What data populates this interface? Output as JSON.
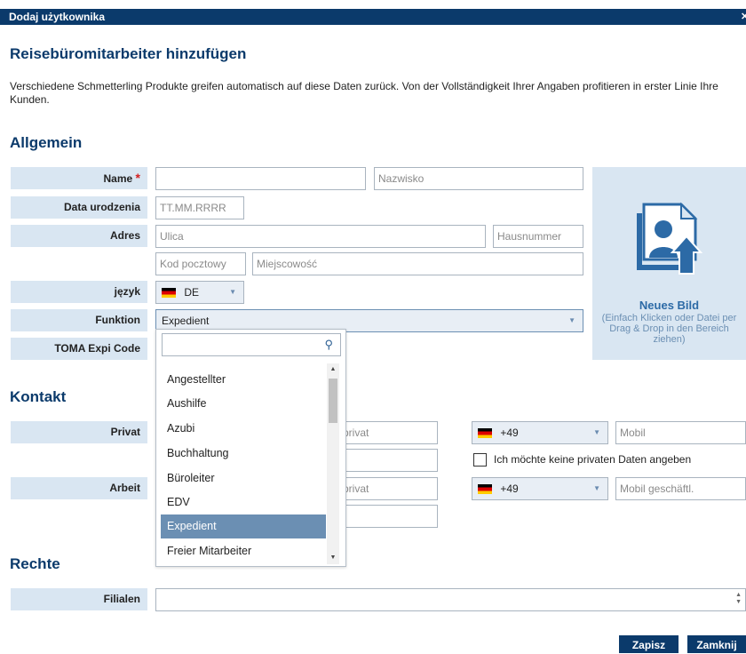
{
  "window": {
    "title": "Dodaj użytkownika",
    "close_icon": "close-icon"
  },
  "page": {
    "title": "Reisebüromitarbeiter hinzufügen",
    "intro": "Verschiedene Schmetterling Produkte greifen automatisch auf diese Daten zurück. Von der Vollständigkeit Ihrer Angaben profitieren in erster Linie Ihre Kunden."
  },
  "sections": {
    "general": "Allgemein",
    "contact": "Kontakt",
    "rights": "Rechte"
  },
  "general": {
    "name_label": "Name",
    "required_mark": "*",
    "first_name_value": "",
    "last_name_placeholder": "Nazwisko",
    "birth_label": "Data urodzenia",
    "birth_placeholder": "TT.MM.RRRR",
    "address_label": "Adres",
    "street_placeholder": "Ulica",
    "house_placeholder": "Hausnummer",
    "zip_placeholder": "Kod pocztowy",
    "city_placeholder": "Miejscowość",
    "language_label": "język",
    "language_value": "DE",
    "function_label": "Funktion",
    "function_value": "Expedient",
    "toma_label": "TOMA Expi Code"
  },
  "photo": {
    "title": "Neues Bild",
    "subtitle": "(Einfach Klicken oder Datei per Drag & Drop in den Bereich ziehen)"
  },
  "dropdown": {
    "search_value": "",
    "items": [
      "Angestellter",
      "Aushilfe",
      "Azubi",
      "Buchhaltung",
      "Büroleiter",
      "EDV",
      "Expedient",
      "Freier Mitarbeiter"
    ],
    "selected": "Expedient",
    "scroll_position": 0.1
  },
  "contact": {
    "private_label": "Privat",
    "work_label": "Arbeit",
    "phone_private_placeholder": "privat",
    "country_code": "+49",
    "mobile_placeholder": "Mobil",
    "mobile_work_placeholder": "Mobil geschäftl.",
    "no_private_label": "Ich möchte keine privaten Daten angeben"
  },
  "rights": {
    "branches_label": "Filialen",
    "branches_value": ""
  },
  "buttons": {
    "save": "Zapisz",
    "close": "Zamknij"
  },
  "colors": {
    "header": "#0b3a6b",
    "label_bg": "#d9e6f2",
    "accent": "#2c6aa6",
    "selected_item": "#6b8fb3",
    "required": "#d42020"
  }
}
